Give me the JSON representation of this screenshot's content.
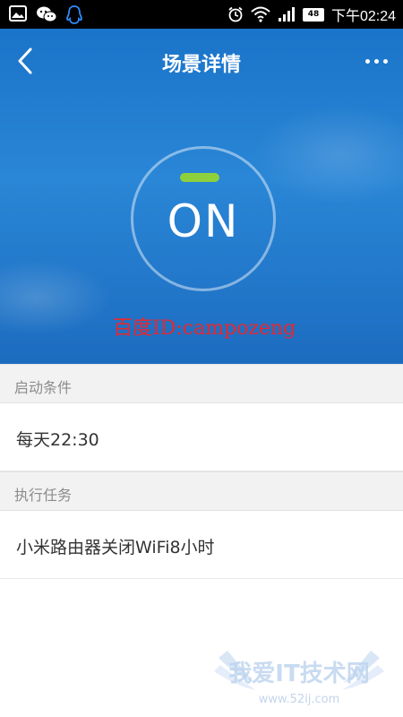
{
  "status_bar": {
    "time": "下午02:24",
    "battery_level": "48",
    "icons": [
      "gallery-icon",
      "wechat-icon",
      "qq-icon",
      "alarm-icon",
      "wifi-icon",
      "signal-icon",
      "battery-icon"
    ]
  },
  "header": {
    "title": "场景详情",
    "back_icon": "chevron-left-icon",
    "more_icon": "more-dots-icon"
  },
  "power": {
    "state": "ON",
    "indicator_color": "#8fd13c"
  },
  "watermark": "百度ID:campozeng",
  "sections": {
    "trigger": {
      "header": "启动条件",
      "item": "每天22:30"
    },
    "action": {
      "header": "执行任务",
      "item": "小米路由器关闭WiFi8小时"
    }
  },
  "site_logo": {
    "name": "我爱IT技术网",
    "url_text": "www.52ij.com"
  },
  "colors": {
    "hero_blue": "#2a86d6",
    "watermark_red": "#e8282f",
    "section_bg": "#f2f2f2"
  }
}
